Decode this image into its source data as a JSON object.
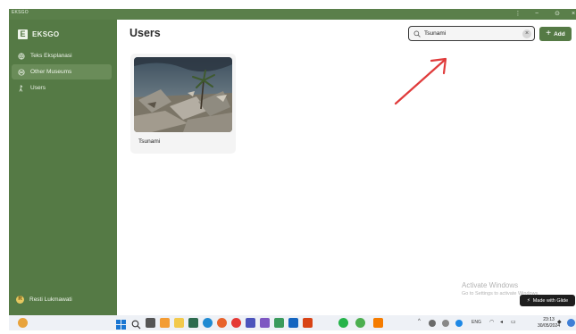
{
  "window": {
    "title": "EKSGO",
    "controls": {
      "menu": "⋮",
      "minimize": "−",
      "restore": "⊙",
      "close": "×"
    }
  },
  "sidebar": {
    "brand": {
      "logo_letter": "E",
      "name": "EKSGO"
    },
    "items": [
      {
        "label": "Teks Eksplanasi",
        "icon": "globe-icon",
        "active": false
      },
      {
        "label": "Other Museums",
        "icon": "globe-alt-icon",
        "active": true
      },
      {
        "label": "Users",
        "icon": "cursor-icon",
        "active": false
      }
    ],
    "user": {
      "initial": "R",
      "name": "Resti Lukmawati"
    }
  },
  "main": {
    "title": "Users",
    "search": {
      "value": "Tsunami",
      "placeholder": "",
      "clear": "×"
    },
    "add_button": {
      "plus": "+",
      "label": "Add"
    },
    "cards": [
      {
        "label": "Tsunami"
      }
    ]
  },
  "watermark": {
    "line1": "Activate Windows",
    "line2": "Go to Settings to activate Windows."
  },
  "glide_badge": {
    "label": "Made with Glide"
  },
  "taskbar": {
    "tray_chevron": "^",
    "language": "ENG",
    "time": "23:13",
    "date": "30/05/2024"
  },
  "colors": {
    "brand_green": "#557a45",
    "sidebar_active": "#6a8c59",
    "arrow_red": "#e03b3b"
  }
}
